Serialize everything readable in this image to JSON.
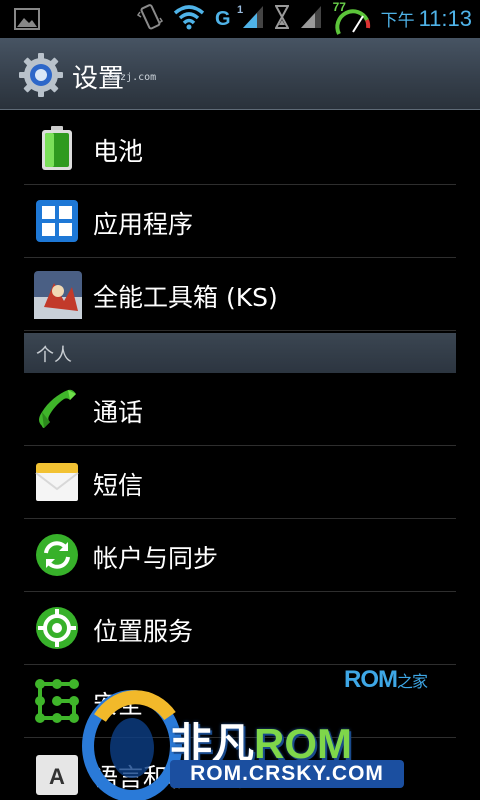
{
  "status_bar": {
    "signal_type": "G",
    "sim_index": "1",
    "battery_percent": "77",
    "time_period": "下午",
    "time": "11:13",
    "icons": [
      "image-icon",
      "vibrate-icon",
      "wifi-icon",
      "signal-icon",
      "hourglass-icon",
      "signal-icon",
      "battery-gauge-icon"
    ]
  },
  "title_bar": {
    "title": "设置",
    "watermark": "romzj.com",
    "icon": "gear-icon"
  },
  "items": [
    {
      "label": "电池",
      "icon": "battery-icon"
    },
    {
      "label": "应用程序",
      "icon": "apps-grid-icon"
    },
    {
      "label": "全能工具箱 (KS)",
      "icon": "toolbox-app-icon"
    }
  ],
  "section_personal": {
    "label": "个人"
  },
  "personal_items": [
    {
      "label": "通话",
      "icon": "phone-icon"
    },
    {
      "label": "短信",
      "icon": "envelope-icon"
    },
    {
      "label": "帐户与同步",
      "icon": "sync-icon"
    },
    {
      "label": "位置服务",
      "icon": "location-icon"
    },
    {
      "label": "安全",
      "icon": "security-pattern-icon"
    },
    {
      "label": "语言和输入法",
      "icon": "keyboard-letter-icon"
    }
  ],
  "watermarks": {
    "rom_zj": "ROM",
    "rom_zj_suffix": "之家",
    "feifan": "非凡",
    "feifan_rom": "ROM",
    "url": "ROM.CRSKY.COM"
  },
  "colors": {
    "accent_blue": "#4fb3e8",
    "title_bar": "#3a4552",
    "section_header": "#333d48",
    "battery_green": "#5cc43a",
    "phone_green": "#3fb52a"
  }
}
